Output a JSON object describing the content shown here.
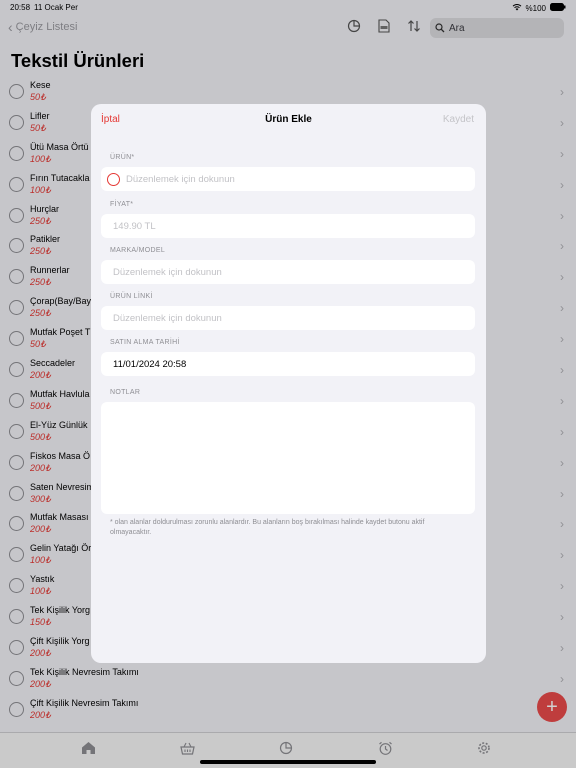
{
  "status": {
    "time": "20:58",
    "date": "11 Ocak Per",
    "battery": "%100"
  },
  "nav": {
    "back_label": "Çeyiz Listesi",
    "search_placeholder": "Ara"
  },
  "page_title": "Tekstil Ürünleri",
  "items": [
    {
      "name": "Kese",
      "price": "50₺"
    },
    {
      "name": "Lifler",
      "price": "50₺"
    },
    {
      "name": "Ütü Masa Örtü",
      "price": "100₺"
    },
    {
      "name": "Fırın Tutacakla",
      "price": "100₺"
    },
    {
      "name": "Hurçlar",
      "price": "250₺"
    },
    {
      "name": "Patikler",
      "price": "250₺"
    },
    {
      "name": "Runnerlar",
      "price": "250₺"
    },
    {
      "name": "Çorap(Bay/Bay",
      "price": "250₺"
    },
    {
      "name": "Mutfak Poşet T",
      "price": "50₺"
    },
    {
      "name": "Seccadeler",
      "price": "200₺"
    },
    {
      "name": "Mutfak Havlula",
      "price": "500₺"
    },
    {
      "name": "El-Yüz Günlük",
      "price": "500₺"
    },
    {
      "name": "Fiskos Masa Ö",
      "price": "200₺"
    },
    {
      "name": "Saten Nevresim",
      "price": "300₺"
    },
    {
      "name": "Mutfak Masası",
      "price": "200₺"
    },
    {
      "name": "Gelin Yatağı Ör",
      "price": "100₺"
    },
    {
      "name": "Yastık",
      "price": "100₺"
    },
    {
      "name": "Tek Kişilik Yorg",
      "price": "150₺"
    },
    {
      "name": "Çift Kişilik Yorg",
      "price": "200₺"
    },
    {
      "name": "Tek Kişilik Nevresim Takımı",
      "price": "200₺"
    },
    {
      "name": "Çift Kişilik Nevresim Takımı",
      "price": "200₺"
    }
  ],
  "modal": {
    "cancel_label": "İptal",
    "title": "Ürün Ekle",
    "save_label": "Kaydet",
    "product_label": "ÜRÜN*",
    "product_placeholder": "Düzenlemek için dokunun",
    "price_label": "FİYAT*",
    "price_placeholder": "149.90 TL",
    "brand_label": "MARKA/MODEL",
    "brand_placeholder": "Düzenlemek için dokunun",
    "link_label": "ÜRÜN LİNKİ",
    "link_placeholder": "Düzenlemek için dokunun",
    "date_label": "SATIN ALMA TARİHİ",
    "date_value": "11/01/2024 20:58",
    "notes_label": "NOTLAR",
    "footnote": "* olan alanlar doldurulması zorunlu alanlardır. Bu alanların boş bırakılması halinde kaydet butonu aktif olmayacaktır."
  },
  "colors": {
    "accent": "#e53935",
    "fab": "#e94b4b"
  },
  "icons": [
    "pie-chart-icon",
    "pdf-icon",
    "sort-icon",
    "search-icon",
    "home-icon",
    "basket-icon",
    "stats-icon",
    "alarm-icon",
    "settings-icon",
    "plus-icon"
  ]
}
